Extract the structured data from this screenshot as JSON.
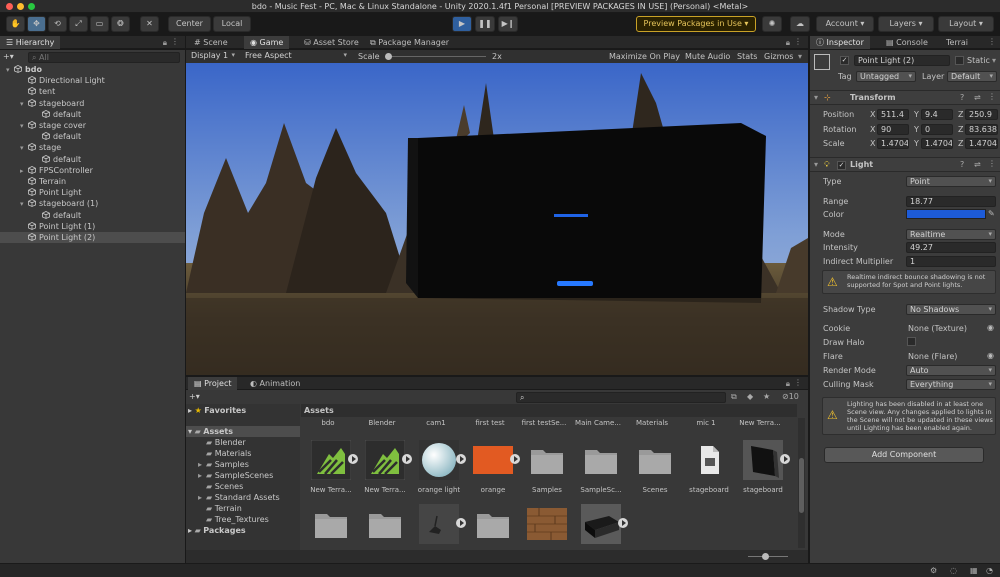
{
  "window": {
    "title": "bdo - Music Fest - PC, Mac & Linux Standalone - Unity 2020.1.4f1 Personal [PREVIEW PACKAGES IN USE] (Personal) <Metal>"
  },
  "toolbar": {
    "center_label": "Center",
    "local_label": "Local",
    "preview_label": "Preview Packages in Use",
    "account_label": "Account",
    "layers_label": "Layers",
    "layout_label": "Layout"
  },
  "hierarchy": {
    "tab": "Hierarchy",
    "search_placeholder": "All",
    "items": [
      {
        "label": "bdo",
        "depth": 0,
        "bold": true,
        "arrow": "▾",
        "selected": false
      },
      {
        "label": "Directional Light",
        "depth": 1,
        "arrow": "",
        "selected": false
      },
      {
        "label": "tent",
        "depth": 1,
        "arrow": "",
        "selected": false
      },
      {
        "label": "stageboard",
        "depth": 1,
        "arrow": "▾",
        "selected": false
      },
      {
        "label": "default",
        "depth": 2,
        "arrow": "",
        "selected": false
      },
      {
        "label": "stage cover",
        "depth": 1,
        "arrow": "▾",
        "selected": false
      },
      {
        "label": "default",
        "depth": 2,
        "arrow": "",
        "selected": false
      },
      {
        "label": "stage",
        "depth": 1,
        "arrow": "▾",
        "selected": false
      },
      {
        "label": "default",
        "depth": 2,
        "arrow": "",
        "selected": false
      },
      {
        "label": "FPSController",
        "depth": 1,
        "arrow": "▸",
        "selected": false
      },
      {
        "label": "Terrain",
        "depth": 1,
        "arrow": "",
        "selected": false
      },
      {
        "label": "Point Light",
        "depth": 1,
        "arrow": "",
        "selected": false
      },
      {
        "label": "stageboard (1)",
        "depth": 1,
        "arrow": "▾",
        "selected": false
      },
      {
        "label": "default",
        "depth": 2,
        "arrow": "",
        "selected": false
      },
      {
        "label": "Point Light (1)",
        "depth": 1,
        "arrow": "",
        "selected": false
      },
      {
        "label": "Point Light (2)",
        "depth": 1,
        "arrow": "",
        "selected": true
      }
    ]
  },
  "center_tabs": [
    "Scene",
    "Game",
    "Asset Store",
    "Package Manager"
  ],
  "game_bar": {
    "display": "Display 1",
    "aspect": "Free Aspect",
    "scale_label": "Scale",
    "scale_value": "2x",
    "maximize": "Maximize On Play",
    "mute": "Mute Audio",
    "stats": "Stats",
    "gizmos": "Gizmos"
  },
  "project": {
    "tabs": [
      "Project",
      "Animation"
    ],
    "count": "10",
    "tree": {
      "favorites": "Favorites",
      "assets": "Assets",
      "folders": [
        {
          "label": "Blender",
          "arrow": ""
        },
        {
          "label": "Materials",
          "arrow": ""
        },
        {
          "label": "Samples",
          "arrow": "▸"
        },
        {
          "label": "SampleScenes",
          "arrow": "▸"
        },
        {
          "label": "Scenes",
          "arrow": ""
        },
        {
          "label": "Standard Assets",
          "arrow": "▸"
        },
        {
          "label": "Terrain",
          "arrow": ""
        },
        {
          "label": "Tree_Textures",
          "arrow": ""
        }
      ],
      "packages": "Packages"
    },
    "breadcrumb": "Assets",
    "header_row": [
      "bdo",
      "Blender",
      "cam1",
      "first test",
      "first testSe...",
      "Main Came...",
      "Materials",
      "mic 1",
      "New Terra..."
    ],
    "assets_row1": [
      {
        "label": "New Terra...",
        "kind": "terrain"
      },
      {
        "label": "New Terra...",
        "kind": "terrain"
      },
      {
        "label": "orange light",
        "kind": "sphere"
      },
      {
        "label": "orange",
        "kind": "orange"
      },
      {
        "label": "Samples",
        "kind": "folder"
      },
      {
        "label": "SampleSc...",
        "kind": "folder"
      },
      {
        "label": "Scenes",
        "kind": "folder"
      },
      {
        "label": "stageboard",
        "kind": "file"
      },
      {
        "label": "stageboard",
        "kind": "board"
      }
    ],
    "assets_row2": [
      {
        "kind": "folder"
      },
      {
        "kind": "folder"
      },
      {
        "kind": "model"
      },
      {
        "kind": "folder"
      },
      {
        "kind": "wood"
      },
      {
        "kind": "box"
      }
    ]
  },
  "inspector": {
    "tabs": [
      "Inspector",
      "Console",
      "Terrai"
    ],
    "object_name": "Point Light (2)",
    "static_label": "Static",
    "tag_label": "Tag",
    "tag_value": "Untagged",
    "layer_label": "Layer",
    "layer_value": "Default",
    "transform": {
      "title": "Transform",
      "position_label": "Position",
      "rotation_label": "Rotation",
      "scale_label": "Scale",
      "position": {
        "x": "511.4",
        "y": "9.4",
        "z": "250.9"
      },
      "rotation": {
        "x": "90",
        "y": "0",
        "z": "83.638"
      },
      "scale": {
        "x": "1.4704",
        "y": "1.4704",
        "z": "1.4704"
      }
    },
    "light": {
      "title": "Light",
      "type_label": "Type",
      "type_value": "Point",
      "range_label": "Range",
      "range_value": "18.77",
      "color_label": "Color",
      "color_value": "#1d5bd8",
      "mode_label": "Mode",
      "mode_value": "Realtime",
      "intensity_label": "Intensity",
      "intensity_value": "49.27",
      "indirect_label": "Indirect Multiplier",
      "indirect_value": "1",
      "warning1": "Realtime indirect bounce shadowing is not supported for Spot and Point lights.",
      "shadow_label": "Shadow Type",
      "shadow_value": "No Shadows",
      "cookie_label": "Cookie",
      "cookie_value": "None (Texture)",
      "halo_label": "Draw Halo",
      "flare_label": "Flare",
      "flare_value": "None (Flare)",
      "render_label": "Render Mode",
      "render_value": "Auto",
      "culling_label": "Culling Mask",
      "culling_value": "Everything",
      "warning2": "Lighting has been disabled in at least one Scene view. Any changes applied to lights in the Scene will not be updated in these views until Lighting has been enabled again."
    },
    "add_component": "Add Component"
  },
  "colors": {
    "accent": "#4a6e8f",
    "panel": "#383838",
    "light_color": "#1d5bd8"
  }
}
